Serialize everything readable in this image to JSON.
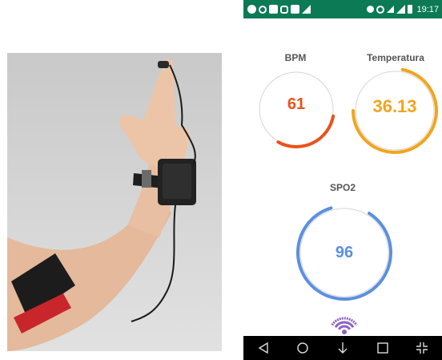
{
  "status_bar": {
    "time": "19:17",
    "left_icons": [
      "spotify-icon",
      "whatsapp-icon",
      "gallery-icon",
      "instagram-icon",
      "image-icon",
      "play-store-icon"
    ],
    "right_icons": [
      "bluetooth-icon",
      "alarm-icon",
      "vpn-key-icon",
      "signal-icon",
      "battery-icon"
    ]
  },
  "metrics": {
    "bpm": {
      "label": "BPM",
      "value": "61",
      "color": "#e8531b",
      "level": 0.3
    },
    "temperature": {
      "label": "Temperatura",
      "value": "36.13",
      "color": "#f1a51d",
      "level": 0.72
    },
    "spo2": {
      "label": "SPO2",
      "value": "96",
      "color": "#5b8fe0",
      "level": 0.96
    }
  },
  "wifi_icon": {
    "color": "#8e62c7"
  },
  "nav_bar": {
    "buttons": [
      "back-icon",
      "home-icon",
      "download-icon",
      "recents-icon",
      "fullscreen-exit-icon"
    ]
  }
}
